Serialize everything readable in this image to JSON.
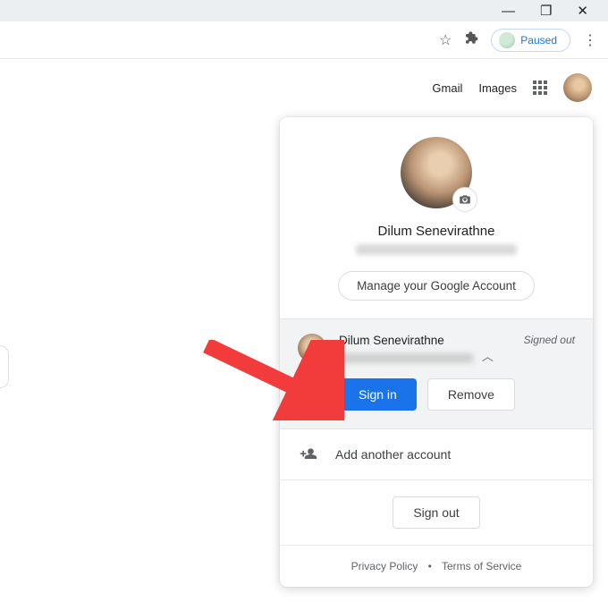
{
  "window": {
    "minimize": "—",
    "maximize": "❐",
    "close": "✕"
  },
  "address_bar": {
    "paused_label": "Paused"
  },
  "top_nav": {
    "gmail": "Gmail",
    "images": "Images"
  },
  "panel": {
    "name": "Dilum Senevirathne",
    "manage": "Manage your Google Account",
    "account": {
      "name": "Dilum Senevirathne",
      "status": "Signed out",
      "sign_in": "Sign in",
      "remove": "Remove"
    },
    "add_account": "Add another account",
    "sign_out": "Sign out",
    "privacy": "Privacy Policy",
    "terms": "Terms of Service"
  }
}
